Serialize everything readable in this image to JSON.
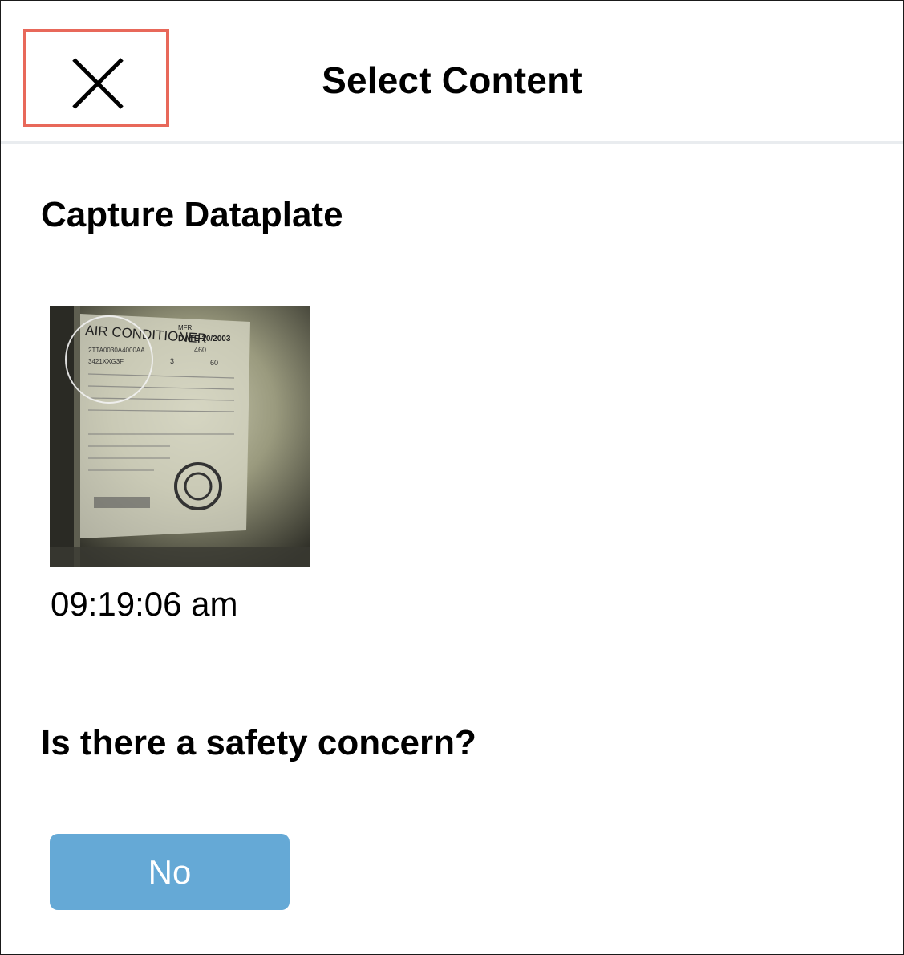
{
  "header": {
    "title": "Select Content",
    "close_icon": "close-icon",
    "close_highlight_color": "#e8685a"
  },
  "capture": {
    "title": "Capture Dataplate",
    "photo": {
      "plate_title": "AIR CONDITIONER",
      "mfr": "MFR",
      "date": "DATE 10/2003",
      "model": "2TTA0030A4000AA",
      "serial": "3421XXG3F",
      "volts": "460",
      "ph": "3",
      "hz": "60"
    },
    "timestamp": "09:19:06 am"
  },
  "safety": {
    "question": "Is there a safety concern?",
    "answer_label": "No",
    "answer_color": "#65a9d6"
  }
}
